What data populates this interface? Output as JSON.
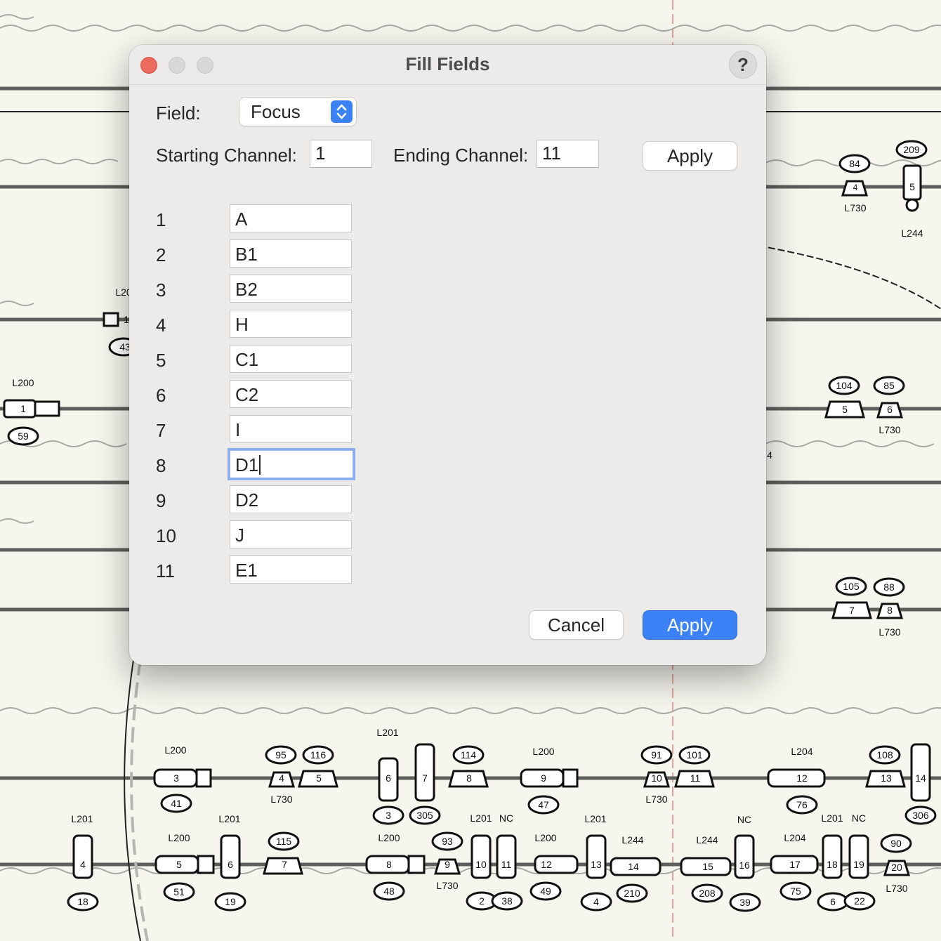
{
  "dialog": {
    "title": "Fill Fields",
    "help_label": "?",
    "field_label": "Field:",
    "field_value": "Focus",
    "starting_label": "Starting Channel:",
    "starting_value": "1",
    "ending_label": "Ending Channel:",
    "ending_value": "11",
    "apply_top_label": "Apply",
    "cancel_label": "Cancel",
    "apply_label": "Apply",
    "rows": [
      {
        "channel": "1",
        "value": "A"
      },
      {
        "channel": "2",
        "value": "B1"
      },
      {
        "channel": "3",
        "value": "B2"
      },
      {
        "channel": "4",
        "value": "H"
      },
      {
        "channel": "5",
        "value": "C1"
      },
      {
        "channel": "6",
        "value": "C2"
      },
      {
        "channel": "7",
        "value": "I"
      },
      {
        "channel": "8",
        "value": "D1"
      },
      {
        "channel": "9",
        "value": "D2"
      },
      {
        "channel": "10",
        "value": "J"
      },
      {
        "channel": "11",
        "value": "E1"
      }
    ]
  },
  "plot": {
    "labels": {
      "top_right": [
        "84",
        "4",
        "L730",
        "209",
        "5",
        "L244"
      ],
      "mid_left": [
        "L20",
        "1",
        "43",
        "L200",
        "1",
        "59"
      ],
      "mid_right": [
        "104",
        "5",
        "85",
        "6",
        "L730",
        "4",
        "105",
        "7",
        "88",
        "8",
        "L730"
      ],
      "row1": [
        "L200",
        "3",
        "41",
        "95",
        "4",
        "116",
        "5",
        "L730",
        "L201",
        "6",
        "3",
        "7",
        "305",
        "114",
        "8",
        "L200",
        "9",
        "47",
        "91",
        "10",
        "101",
        "11",
        "L730",
        "L204",
        "12",
        "76",
        "108",
        "13",
        "14",
        "306"
      ],
      "row2": [
        "L201",
        "4",
        "18",
        "L200",
        "5",
        "51",
        "L201",
        "6",
        "19",
        "115",
        "7",
        "L200",
        "8",
        "48",
        "93",
        "9",
        "L730",
        "L201",
        "NC",
        "10",
        "2",
        "11",
        "38",
        "L200",
        "12",
        "49",
        "L201",
        "13",
        "4",
        "L244",
        "14",
        "210",
        "L244",
        "15",
        "208",
        "NC",
        "16",
        "39",
        "L204",
        "17",
        "75",
        "L201",
        "NC",
        "18",
        "6",
        "19",
        "22",
        "90",
        "20",
        "L730"
      ]
    }
  }
}
